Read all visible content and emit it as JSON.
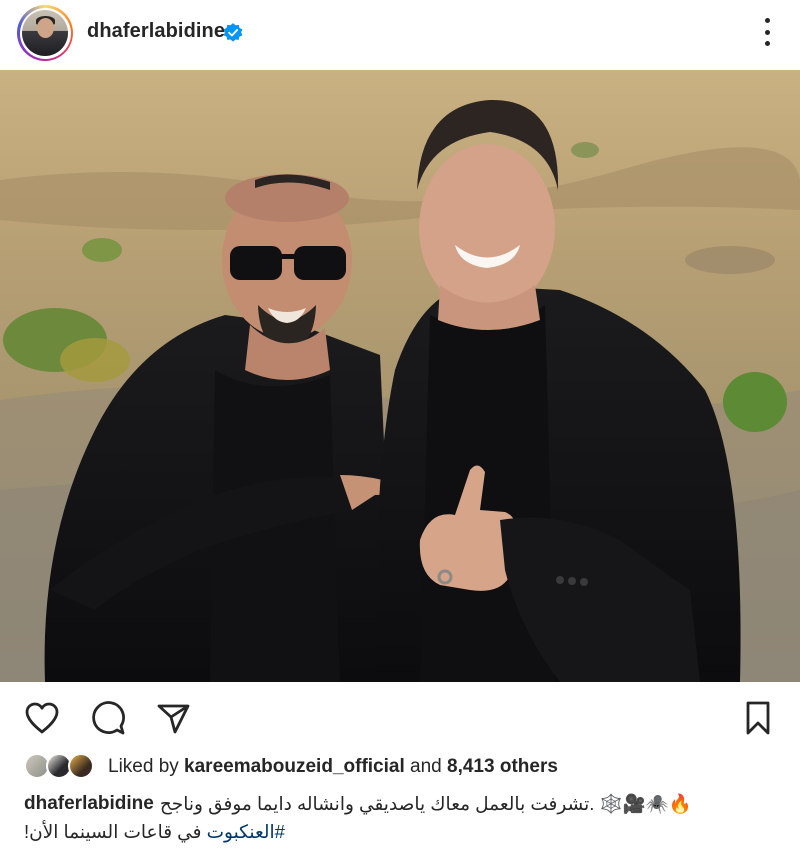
{
  "post": {
    "username": "dhaferlabidine",
    "verified": true,
    "more_icon": "more-vertical-icon",
    "photo_alt": ""
  },
  "actions": {
    "like_icon": "heart-icon",
    "comment_icon": "comment-icon",
    "share_icon": "send-icon",
    "save_icon": "bookmark-icon"
  },
  "likes": {
    "prefix": "Liked by ",
    "user": "kareemabouzeid_official",
    "middle": " and ",
    "count": "8,413 others"
  },
  "caption": {
    "username": "dhaferlabidine",
    "text": "🔥🕷️🎥🕸️ .تشرفت بالعمل معاك ياصديقي وانشاله دايما موفق وناجح",
    "hashtag": "#العنكبوت",
    "text2": " في قاعات السينما الأن!"
  },
  "colors": {
    "text": "#262626",
    "verified": "#0095f6",
    "hashtag": "#00376b"
  }
}
